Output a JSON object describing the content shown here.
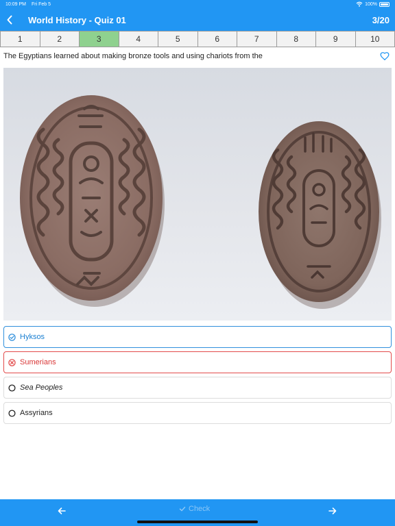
{
  "status": {
    "time": "10:09 PM",
    "date": "Fri Feb 5",
    "battery": "100%"
  },
  "header": {
    "title": "World History - Quiz 01",
    "progress": "3/20"
  },
  "tabs": [
    {
      "label": "1"
    },
    {
      "label": "2"
    },
    {
      "label": "3"
    },
    {
      "label": "4"
    },
    {
      "label": "5"
    },
    {
      "label": "6"
    },
    {
      "label": "7"
    },
    {
      "label": "8"
    },
    {
      "label": "9"
    },
    {
      "label": "10"
    }
  ],
  "current_tab": "3",
  "question": {
    "text": "The Egyptians learned about making bronze tools and using chariots from the"
  },
  "answers": [
    {
      "label": "Hyksos",
      "state": "correct"
    },
    {
      "label": "Sumerians",
      "state": "wrong"
    },
    {
      "label": "Sea Peoples",
      "state": "unselected"
    },
    {
      "label": "Assyrians",
      "state": "unselected"
    }
  ],
  "footer": {
    "check_label": "Check"
  },
  "colors": {
    "primary": "#2196f3",
    "current_tab": "#8fd18f",
    "correct": "#2f8fdc",
    "wrong": "#e24a4a"
  }
}
